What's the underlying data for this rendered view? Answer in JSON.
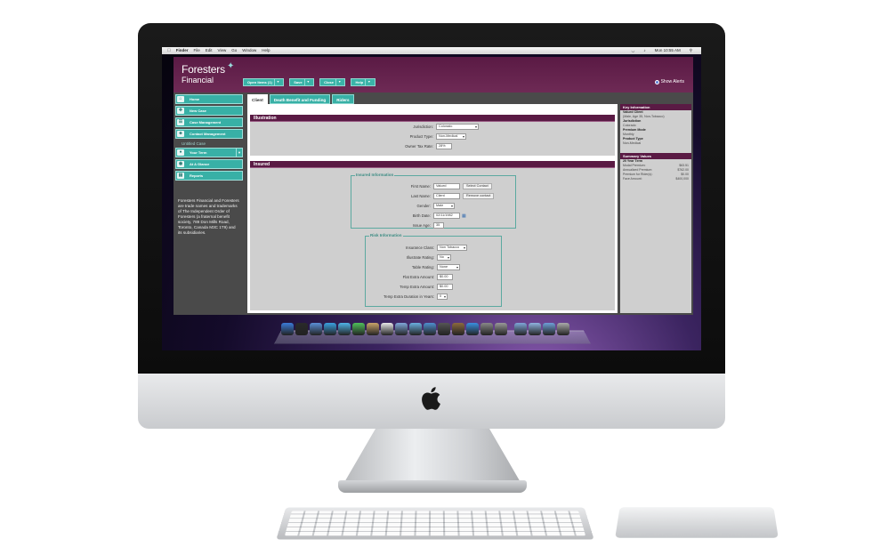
{
  "mac_menubar": {
    "apple": "",
    "app": "Finder",
    "items": [
      "File",
      "Edit",
      "View",
      "Go",
      "Window",
      "Help"
    ],
    "clock": "Mon 10:55 AM"
  },
  "brand": {
    "name_line1": "Foresters",
    "name_line2": "Financial",
    "accent": "#5a1a44",
    "teal": "#38b0a6"
  },
  "toolbar": {
    "open_items": "Open Items (1)",
    "save": "Save",
    "close": "Close",
    "help": "Help",
    "show_alerts": "Show Alerts"
  },
  "sidebar": {
    "items": [
      {
        "label": "Home",
        "icon": "home-icon"
      },
      {
        "label": "New Case",
        "icon": "new-case-icon"
      },
      {
        "label": "Case Management",
        "icon": "case-management-icon"
      },
      {
        "label": "Contact Management",
        "icon": "contacts-icon"
      }
    ],
    "section_label": "Untitled Case",
    "case_items": [
      {
        "label": "Your Term",
        "icon": "term-icon"
      },
      {
        "label": "At A Glance",
        "icon": "glance-icon"
      },
      {
        "label": "Reports",
        "icon": "reports-icon"
      }
    ],
    "footer_text": "Foresters Financial and Foresters are trade names and trademarks of The Independent Order of Foresters (a fraternal benefit society, 789 Don Mills Road, Toronto, Canada M3C 1T9) and its subsidiaries."
  },
  "tabs": [
    "Client",
    "Death Benefit and Funding",
    "Riders"
  ],
  "illustration": {
    "title": "Illustration",
    "jurisdiction_label": "Jurisdiction:",
    "jurisdiction_value": "Colorado",
    "product_type_label": "Product Type:",
    "product_type_value": "Non-Medical",
    "owner_tax_label": "Owner Tax Rate:",
    "owner_tax_value": "28%"
  },
  "insured": {
    "title": "Insured",
    "insured_info_legend": "Insured Information",
    "first_name_label": "First Name:",
    "first_name_value": "Valued",
    "select_contact": "Select Contact",
    "last_name_label": "Last Name:",
    "last_name_value": "Client",
    "remove_contact": "Remove contact",
    "gender_label": "Gender:",
    "gender_value": "Male",
    "birth_date_label": "Birth Date:",
    "birth_date_value": "02/11/1982",
    "issue_age_label": "Issue Age:",
    "issue_age_value": "35",
    "risk_legend": "Risk Information",
    "insurance_class_label": "Insurance Class:",
    "insurance_class_value": "Non Tobacco",
    "illustrate_rating_label": "Illustrate Rating:",
    "illustrate_rating_value": "No",
    "table_rating_label": "Table Rating:",
    "table_rating_value": "None",
    "flat_extra_label": "Flat Extra Amount:",
    "flat_extra_value": "$0.00",
    "temp_extra_label": "Temp Extra Amount:",
    "temp_extra_value": "$0.00",
    "temp_duration_label": "Temp Extra Duration in Years:",
    "temp_duration_value": "0"
  },
  "key_info": {
    "title": "Key Information",
    "lines": [
      {
        "text": "Valued Client",
        "bold": true
      },
      {
        "text": "(Male, Age 35, Non-Tobacco)",
        "bold": false
      },
      {
        "text": "Jurisdiction",
        "bold": true
      },
      {
        "text": "Colorado",
        "bold": false
      },
      {
        "text": "Premium Mode",
        "bold": true
      },
      {
        "text": "Monthly",
        "bold": false
      },
      {
        "text": "Product Type",
        "bold": true
      },
      {
        "text": "Non-Medical",
        "bold": false
      }
    ]
  },
  "summary": {
    "title": "Summary Values",
    "subtitle": "20 Year Term",
    "rows": [
      {
        "k": "Modal Premium:",
        "v": "$63.51"
      },
      {
        "k": "Annualized Premium:",
        "v": "$762.00"
      },
      {
        "k": "Premium for Rider(s):",
        "v": "$0.00"
      },
      {
        "k": "Face Amount:",
        "v": "$400,000"
      }
    ]
  },
  "dock_icons": [
    "finder-icon",
    "dashboard-icon",
    "mail-icon",
    "safari-icon",
    "ichat-icon",
    "facetime-icon",
    "address-book-icon",
    "ical-icon",
    "preview-icon",
    "itunes-icon",
    "iphoto-icon",
    "imovie-icon",
    "garageband-icon",
    "app-store-icon",
    "time-machine-icon",
    "system-preferences-icon",
    "applications-folder-icon",
    "documents-folder-icon",
    "downloads-folder-icon",
    "trash-icon"
  ]
}
